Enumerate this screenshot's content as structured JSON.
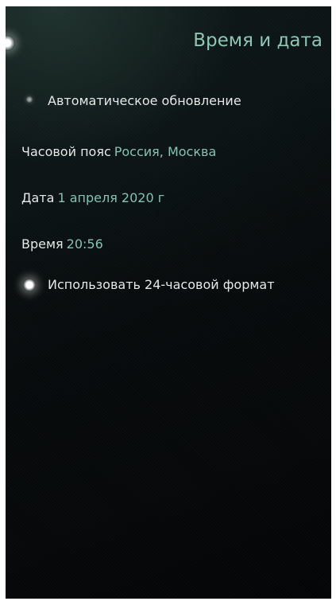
{
  "header": {
    "title": "Время и дата"
  },
  "settings": {
    "auto_update": {
      "label": "Автоматическое обновление",
      "checked": false
    },
    "timezone": {
      "label": "Часовой пояс",
      "value": "Россия, Москва"
    },
    "date": {
      "label": "Дата",
      "value": "1 апреля 2020 г"
    },
    "time": {
      "label": "Время",
      "value": "20:56"
    },
    "format24": {
      "label": "Использовать 24-часовой формат",
      "checked": true
    }
  },
  "colors": {
    "accent": "#8ec6b3",
    "text": "#e4e8e6",
    "background": "#080c0d"
  },
  "icons": {
    "pulley": "pulley-menu-indicator-icon"
  }
}
